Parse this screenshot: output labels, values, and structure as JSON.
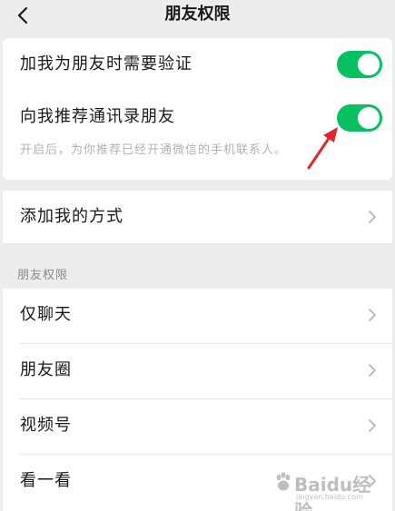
{
  "nav": {
    "title": "朋友权限",
    "back_icon": "chevron-left-icon"
  },
  "verification": {
    "label": "加我为朋友时需要验证",
    "enabled": true
  },
  "contacts_recommend": {
    "label": "向我推荐通讯录朋友",
    "enabled": true,
    "hint": "开启后，为你推荐已经开通微信的手机联系人。"
  },
  "add_methods": {
    "label": "添加我的方式"
  },
  "friend_permissions": {
    "section_title": "朋友权限",
    "items": [
      {
        "label": "仅聊天"
      },
      {
        "label": "朋友圈"
      },
      {
        "label": "视频号"
      },
      {
        "label": "看一看"
      }
    ]
  },
  "annotation": {
    "color": "#e3262a"
  },
  "watermark": {
    "text": "Baidu经验",
    "url": "jingyan.baidu.com"
  },
  "colors": {
    "accent": "#07c160",
    "background": "#ededed"
  }
}
